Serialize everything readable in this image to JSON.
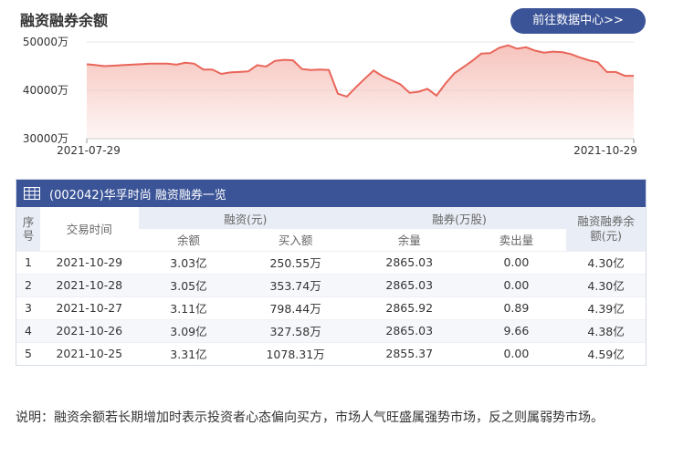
{
  "page": {
    "title": "融资融券余额",
    "data_center_button": "前往数据中心>>"
  },
  "chart_data": {
    "type": "area",
    "ylim": [
      30000,
      50000
    ],
    "yticks": [
      50000,
      40000,
      30000
    ],
    "ytick_labels": [
      "50000万",
      "40000万",
      "30000万"
    ],
    "x_start_label": "2021-07-29",
    "x_end_label": "2021-10-29",
    "color": "#e9655a",
    "fill_color": "#f6c1ba",
    "values": [
      45400,
      45200,
      45000,
      45100,
      45200,
      45300,
      45400,
      45500,
      45500,
      45500,
      45300,
      45700,
      45500,
      44300,
      44300,
      43400,
      43700,
      43800,
      43900,
      45200,
      44900,
      46100,
      46300,
      46200,
      44400,
      44200,
      44300,
      44200,
      39300,
      38700,
      40600,
      42400,
      44100,
      42900,
      42100,
      41200,
      39500,
      39700,
      40300,
      38900,
      41400,
      43500,
      44800,
      46100,
      47600,
      47700,
      48800,
      49300,
      48600,
      48900,
      48200,
      47800,
      48000,
      47900,
      47500,
      46800,
      46200,
      45800,
      43800,
      43800,
      43000,
      43000
    ]
  },
  "table": {
    "title": "(002042)华孚时尚 融资融券一览",
    "grid_icon": "grid-icon",
    "headers": {
      "seq": "序号",
      "date": "交易时间",
      "margin_group": "融资(元)",
      "short_group": "融券(万股)",
      "total": "融资融券余额(元)",
      "balance": "余额",
      "buy": "买入额",
      "remain": "余量",
      "sell": "卖出量"
    },
    "rows": [
      {
        "seq": "1",
        "date": "2021-10-29",
        "balance": "3.03亿",
        "buy": "250.55万",
        "remain": "2865.03",
        "sell": "0.00",
        "total": "4.30亿"
      },
      {
        "seq": "2",
        "date": "2021-10-28",
        "balance": "3.05亿",
        "buy": "353.74万",
        "remain": "2865.03",
        "sell": "0.00",
        "total": "4.30亿"
      },
      {
        "seq": "3",
        "date": "2021-10-27",
        "balance": "3.11亿",
        "buy": "798.44万",
        "remain": "2865.92",
        "sell": "0.89",
        "total": "4.39亿"
      },
      {
        "seq": "4",
        "date": "2021-10-26",
        "balance": "3.09亿",
        "buy": "327.58万",
        "remain": "2865.03",
        "sell": "9.66",
        "total": "4.38亿"
      },
      {
        "seq": "5",
        "date": "2021-10-25",
        "balance": "3.31亿",
        "buy": "1078.31万",
        "remain": "2855.37",
        "sell": "0.00",
        "total": "4.59亿"
      }
    ]
  },
  "note": "说明：融资余额若长期增加时表示投资者心态偏向买方，市场人气旺盛属强势市场，反之则属弱势市场。"
}
